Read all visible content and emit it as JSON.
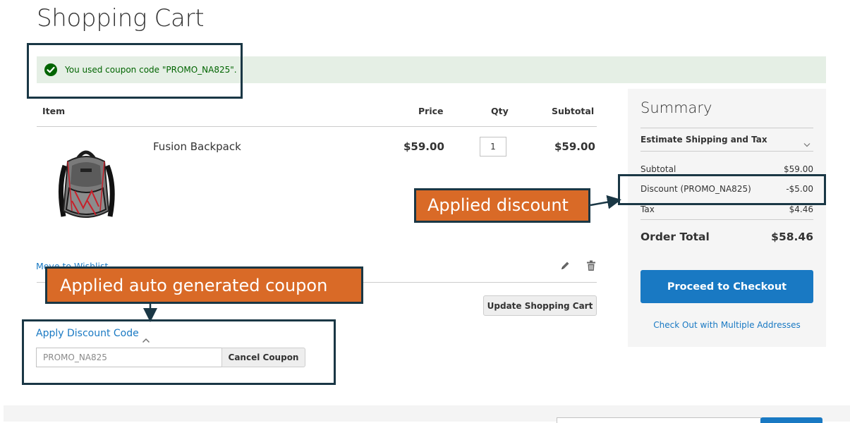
{
  "page": {
    "title": "Shopping Cart"
  },
  "message": {
    "text": "You used coupon code \"PROMO_NA825\"."
  },
  "cart_table": {
    "headers": {
      "item": "Item",
      "price": "Price",
      "qty": "Qty",
      "subtotal": "Subtotal"
    },
    "items": [
      {
        "name": "Fusion Backpack",
        "price": "$59.00",
        "qty": "1",
        "subtotal": "$59.00"
      }
    ],
    "move_to_wishlist": "Move to Wishlist",
    "update_button": "Update Shopping Cart"
  },
  "discount": {
    "title": "Apply Discount Code",
    "code_value": "PROMO_NA825",
    "cancel_button": "Cancel Coupon"
  },
  "summary": {
    "title": "Summary",
    "estimate_label": "Estimate Shipping and Tax",
    "rows": [
      {
        "label": "Subtotal",
        "amount": "$59.00"
      },
      {
        "label": "Discount (PROMO_NA825)",
        "amount": "-$5.00"
      },
      {
        "label": "Tax",
        "amount": "$4.46"
      }
    ],
    "total_label": "Order Total",
    "total_amount": "$58.46",
    "checkout_button": "Proceed to Checkout",
    "multi_address_link": "Check Out with Multiple Addresses"
  },
  "annotations": {
    "applied_discount": "Applied discount",
    "applied_coupon": "Applied auto generated coupon"
  },
  "icons": [
    "check-icon",
    "edit-icon",
    "trash-icon",
    "chevron-up-icon",
    "chevron-down-icon"
  ],
  "colors": {
    "accent": "#1979c3",
    "success_bg": "#e5efe5",
    "success_text": "#006400",
    "annotation_fill": "#d96a27",
    "annotation_border": "#1a3745"
  }
}
